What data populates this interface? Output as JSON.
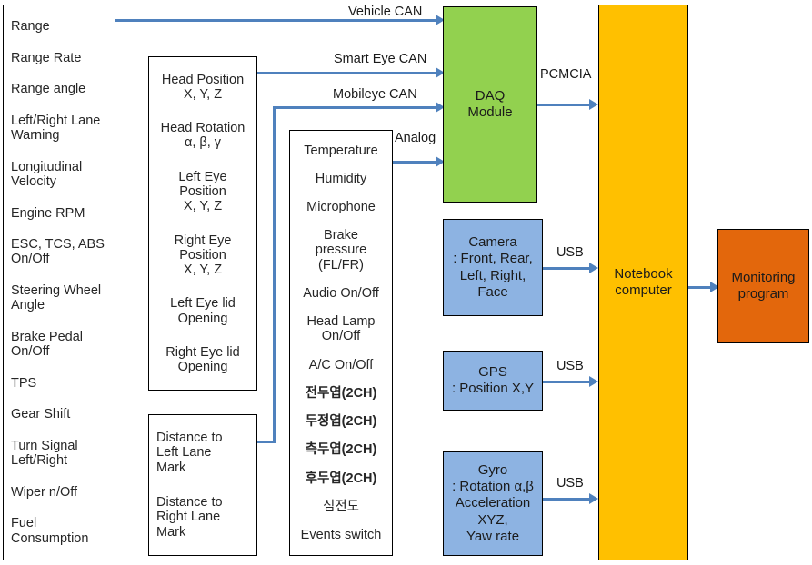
{
  "diagram": {
    "title": "Vehicle data acquisition system architecture",
    "colors": {
      "connector": "#4f81bd",
      "daq": "#92d14f",
      "sensor": "#8db3e2",
      "notebook": "#ffc000",
      "monitor": "#e3670c",
      "box_border": "#000000"
    }
  },
  "vehicle_can_list": {
    "name": "Vehicle CAN signals",
    "items": [
      "Range",
      "Range Rate",
      "Range angle",
      "Left/Right Lane\nWarning",
      "Longitudinal\nVelocity",
      "Engine RPM",
      "ESC, TCS, ABS\nOn/Off",
      "Steering Wheel\nAngle",
      "Brake Pedal\nOn/Off",
      "TPS",
      "Gear Shift",
      "Turn Signal\nLeft/Right",
      "Wiper n/Off",
      "Fuel\nConsumption"
    ]
  },
  "smart_eye_list": {
    "name": "Smart Eye CAN signals",
    "items": [
      "Head Position\nX, Y,  Z",
      "Head Rotation\nα, β, γ",
      "Left Eye\nPosition\nX, Y, Z",
      "Right Eye\nPosition\nX, Y, Z",
      "Left Eye lid\nOpening",
      "Right Eye lid\nOpening"
    ]
  },
  "mobileye_list": {
    "name": "Mobileye CAN signals",
    "items": [
      "Distance to\nLeft Lane\nMark",
      "Distance to\nRight Lane\nMark"
    ]
  },
  "analog_list": {
    "name": "Analog signals",
    "items": [
      {
        "text": "Temperature",
        "bold": false
      },
      {
        "text": "Humidity",
        "bold": false
      },
      {
        "text": "Microphone",
        "bold": false
      },
      {
        "text": "Brake\npressure\n(FL/FR)",
        "bold": false
      },
      {
        "text": "Audio On/Off",
        "bold": false
      },
      {
        "text": "Head Lamp\nOn/Off",
        "bold": false
      },
      {
        "text": "A/C  On/Off",
        "bold": false
      },
      {
        "text": "전두엽(2CH)",
        "bold": true
      },
      {
        "text": "두정엽(2CH)",
        "bold": true
      },
      {
        "text": "측두엽(2CH)",
        "bold": true
      },
      {
        "text": "후두엽(2CH)",
        "bold": true
      },
      {
        "text": "심전도",
        "bold": false
      },
      {
        "text": "Events switch",
        "bold": false
      }
    ]
  },
  "blocks": {
    "daq": "DAQ\nModule",
    "camera": "Camera\n: Front, Rear,\nLeft, Right,\nFace",
    "gps": "GPS\n: Position X,Y",
    "gyro": "Gyro\n: Rotation α,β\nAcceleration\nXYZ,\nYaw rate",
    "notebook": "Notebook\ncomputer",
    "monitor": "Monitoring\nprogram"
  },
  "connections": {
    "vehicle_can": "Vehicle CAN",
    "smart_eye_can": "Smart Eye  CAN",
    "mobileye_can": "Mobileye CAN",
    "analog": "Analog",
    "pcmcia": "PCMCIA",
    "usb_camera": "USB",
    "usb_gps": "USB",
    "usb_gyro": "USB"
  }
}
